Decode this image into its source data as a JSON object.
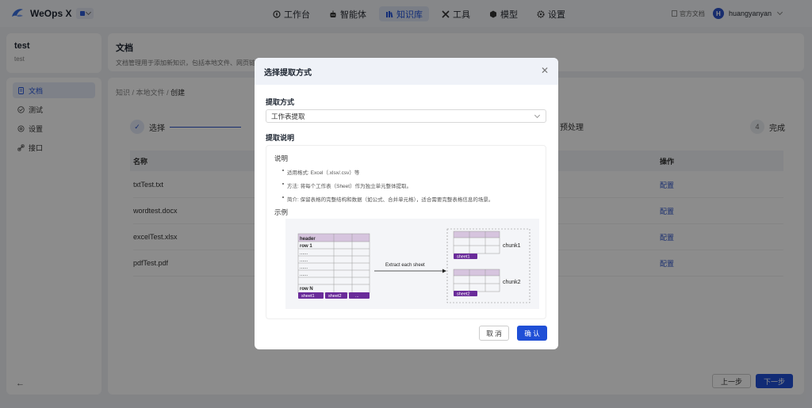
{
  "app": {
    "name": "WeOps X"
  },
  "nav": [
    {
      "label": "工作台",
      "icon": "compass-icon",
      "active": false
    },
    {
      "label": "智能体",
      "icon": "robot-icon",
      "active": false
    },
    {
      "label": "知识库",
      "icon": "books-icon",
      "active": true
    },
    {
      "label": "工具",
      "icon": "tools-icon",
      "active": false
    },
    {
      "label": "模型",
      "icon": "cube-icon",
      "active": false
    },
    {
      "label": "设置",
      "icon": "gear-icon",
      "active": false
    }
  ],
  "top_right": {
    "doc_link": "官方文档",
    "avatar_letter": "H",
    "username": "huangyanyan"
  },
  "left": {
    "title": "test",
    "subtitle": "test",
    "menu": [
      {
        "label": "文档",
        "icon": "document-icon",
        "active": true
      },
      {
        "label": "测试",
        "icon": "test-icon",
        "active": false
      },
      {
        "label": "设置",
        "icon": "settings-icon",
        "active": false
      },
      {
        "label": "接口",
        "icon": "link-icon",
        "active": false
      }
    ]
  },
  "header": {
    "title": "文档",
    "desc": "文档管理用于添加新知识，包括本地文件、网页链接或自定义文本等"
  },
  "breadcrumb": [
    "知识",
    "本地文件",
    "创建"
  ],
  "steps": [
    {
      "label": "选择",
      "number": "✓"
    },
    {
      "label": "预处理",
      "number": ""
    },
    {
      "label": "完成",
      "number": "4"
    }
  ],
  "table": {
    "headers": {
      "name": "名称",
      "op": "操作"
    },
    "rows": [
      {
        "name": "txtTest.txt",
        "op": "配置"
      },
      {
        "name": "wordtest.docx",
        "op": "配置"
      },
      {
        "name": "excelTest.xlsx",
        "op": "配置"
      },
      {
        "name": "pdfTest.pdf",
        "op": "配置"
      }
    ]
  },
  "footer": {
    "prev": "上一步",
    "next": "下一步"
  },
  "modal": {
    "title": "选择提取方式",
    "method_label": "提取方式",
    "method_value": "工作表提取",
    "desc_label": "提取说明",
    "desc_title": "说明",
    "bullets": [
      "适用格式: Excel（.xlsx/.csv）等",
      "方法: 将每个工作表（Sheet）作为独立单元整体提取。",
      "简介: 保留表格的完整结构和数据（如公式、合并单元格），适合需要完整表格信息的场景。"
    ],
    "example_label": "示例",
    "cancel": "取 消",
    "ok": "确 认"
  },
  "diagram": {
    "header": "header",
    "row1": "row 1",
    "dots": "......",
    "rowN": "row N",
    "sheet1": "sheet1",
    "sheet2": "sheet2",
    "more": "...",
    "arrow_label": "Extract each sheet",
    "chunk1": "chunk1",
    "chunk2": "chunk2"
  },
  "colors": {
    "primary": "#1f4fd6",
    "sheet_tab": "#6a2b9a",
    "header_row": "#d6c4de"
  }
}
